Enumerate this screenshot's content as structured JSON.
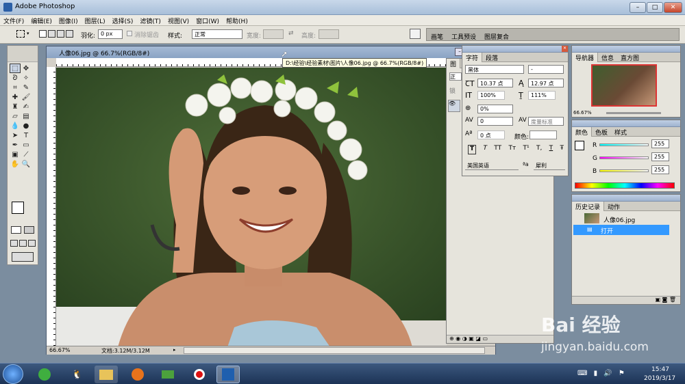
{
  "app": {
    "title": "Adobe Photoshop"
  },
  "window_buttons": {
    "minimize": "–",
    "maximize": "□",
    "close": "✕"
  },
  "menu": [
    "文件(F)",
    "编辑(E)",
    "图像(I)",
    "图层(L)",
    "选择(S)",
    "滤镜(T)",
    "视图(V)",
    "窗口(W)",
    "帮助(H)"
  ],
  "options": {
    "feather_label": "羽化:",
    "feather_value": "0 px",
    "antialias_label": "消除锯齿",
    "style_label": "样式:",
    "style_value": "正常",
    "width_label": "宽度:",
    "height_label": "高度:",
    "palette_tabs": [
      "画笔",
      "工具预设",
      "图层复合"
    ]
  },
  "document": {
    "title": "人像06.jpg @ 66.7%(RGB/8#)",
    "tooltip": "D:\\经验\\经验素材\\图片\\人像06.jpg @ 66.7%(RGB/8#)",
    "zoom": "66.67%",
    "doc_size": "文档:3.12M/3.12M"
  },
  "layers_panel": {
    "tab": "图",
    "blend": "正",
    "lock": "锁"
  },
  "character_panel": {
    "tabs": [
      "字符",
      "段落"
    ],
    "font": "黑体",
    "style": "-",
    "size": "10.37 点",
    "leading": "12.97 点",
    "vscale": "100%",
    "hscale": "111%",
    "tracking_pct": "0%",
    "kerning": "0",
    "tracking_label": "度量标准",
    "baseline": "0 点",
    "color_label": "颜色:",
    "style_buttons": [
      "T",
      "T",
      "TT",
      "Tт",
      "T¹",
      "T,",
      "T",
      "Ŧ"
    ],
    "language": "美国英语",
    "aa_label": "ªa",
    "aa_value": "犀利"
  },
  "navigator": {
    "tabs": [
      "导航器",
      "信息",
      "直方图"
    ],
    "zoom": "66.67%"
  },
  "color_panel": {
    "tabs": [
      "颜色",
      "色板",
      "样式"
    ],
    "r_label": "R",
    "r_value": "255",
    "g_label": "G",
    "g_value": "255",
    "b_label": "B",
    "b_value": "255"
  },
  "history_panel": {
    "tabs": [
      "历史记录",
      "动作"
    ],
    "snapshot": "人像06.jpg",
    "steps": [
      "打开"
    ]
  },
  "taskbar": {
    "time": "15:47",
    "date": "2019/3/17"
  },
  "watermark": {
    "brand": "Bai 经验",
    "url": "jingyan.baidu.com"
  },
  "colors": {
    "accent": "#3399ff",
    "title_bg": "#a8bfd9",
    "panel_bg": "#e6e4dc"
  }
}
